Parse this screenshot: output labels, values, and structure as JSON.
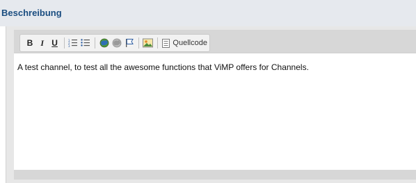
{
  "section": {
    "title": "Beschreibung"
  },
  "toolbar": {
    "bold_label": "B",
    "italic_label": "I",
    "underline_label": "U",
    "source_label": "Quellcode",
    "icons": [
      "ordered-list-icon",
      "unordered-list-icon",
      "link-icon",
      "unlink-icon",
      "anchor-flag-icon",
      "image-icon",
      "source-code-icon"
    ]
  },
  "editor": {
    "content": "A test channel, to test all the awesome functions that ViMP offers for Channels."
  },
  "colors": {
    "header_bg": "#e6e9ee",
    "title": "#1a4d80",
    "panel_bg": "#e7e7e7",
    "editor_bg": "#ffffff"
  }
}
